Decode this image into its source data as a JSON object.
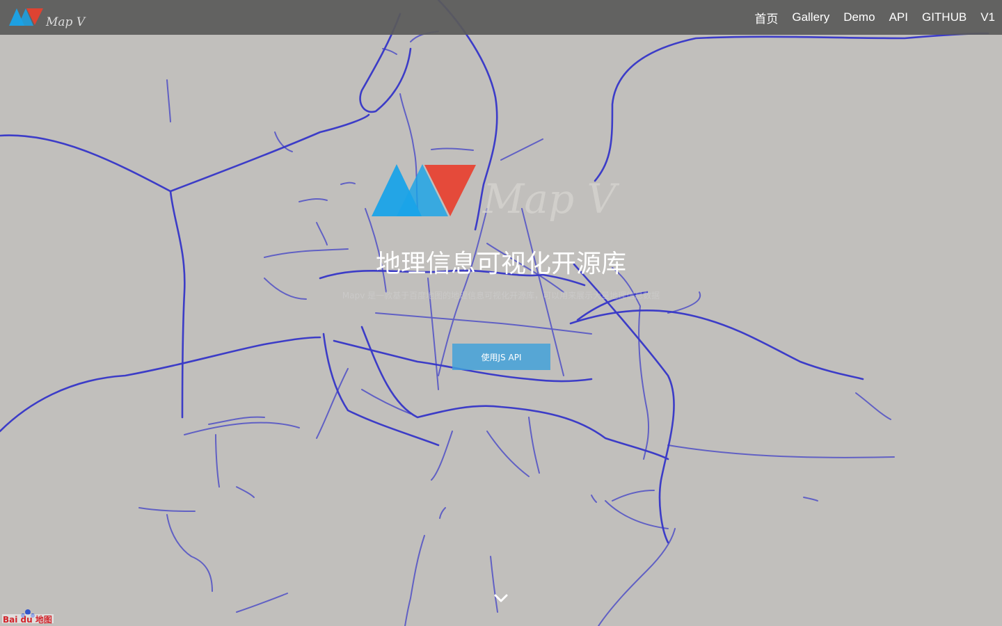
{
  "navbar": {
    "brand_text": "Map V",
    "links": [
      {
        "label": "首页"
      },
      {
        "label": "Gallery"
      },
      {
        "label": "Demo"
      },
      {
        "label": "API"
      },
      {
        "label": "GITHUB"
      },
      {
        "label": "V1"
      }
    ]
  },
  "hero": {
    "logo_text": "Map V",
    "title": "地理信息可视化开源库",
    "subtitle": "Mapv 是一款基于百度地图的地理信息可视化开源库，可以用来展示大量地理信息数据",
    "cta_label": "使用JS API"
  },
  "map_attribution": {
    "logo_text": "Bai du 地图"
  },
  "icons": {
    "scroll": "chevron-down-icon"
  },
  "colors": {
    "background": "#c1bfbc",
    "navbar": "#5a5a5a",
    "road": "#2f2fc8",
    "logo_blue": "#1aa3e8",
    "logo_red": "#e8402f",
    "cta": "#3ea0da"
  }
}
